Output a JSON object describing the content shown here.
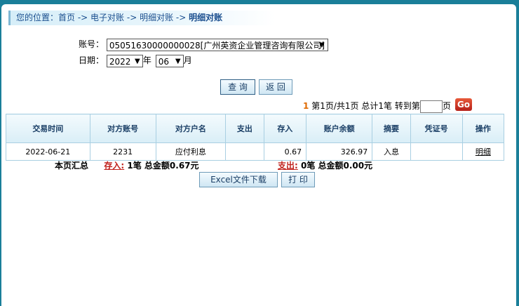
{
  "breadcrumb": {
    "prefix": "您的位置：",
    "items": [
      "首页",
      "电子对账",
      "明细对账"
    ],
    "separator": " -> ",
    "current": "明细对账"
  },
  "form": {
    "account_label": "账号：",
    "account_value": "05051630000000028[广州英资企业管理咨询有限公司]",
    "date_label": "日期：",
    "year_value": "2022",
    "year_suffix": "年",
    "month_value": "06",
    "month_suffix": "月"
  },
  "buttons": {
    "query": "查 询",
    "back": "返 回",
    "excel": "Excel文件下载",
    "print": "打 印",
    "go": "Go"
  },
  "pager": {
    "current_page": "1",
    "page_text": "第1页/共1页",
    "total_text": "总计1笔",
    "jump_prefix": "转到第",
    "jump_suffix": "页"
  },
  "table": {
    "columns": [
      "交易时间",
      "对方账号",
      "对方户名",
      "支出",
      "存入",
      "账户余额",
      "摘要",
      "凭证号",
      "操作"
    ],
    "rows": [
      {
        "time": "2022-06-21",
        "counterparty_account": "2231",
        "counterparty_name": "应付利息",
        "expense": "",
        "deposit": "0.67",
        "balance": "326.97",
        "summary": "入息",
        "voucher": "",
        "action": "明细"
      }
    ]
  },
  "summary": {
    "label": "本页汇总",
    "deposit_label": "存入:",
    "deposit_text": "1笔 总金额0.67元",
    "expense_label": "支出:",
    "expense_text": "0笔 总金额0.00元"
  }
}
